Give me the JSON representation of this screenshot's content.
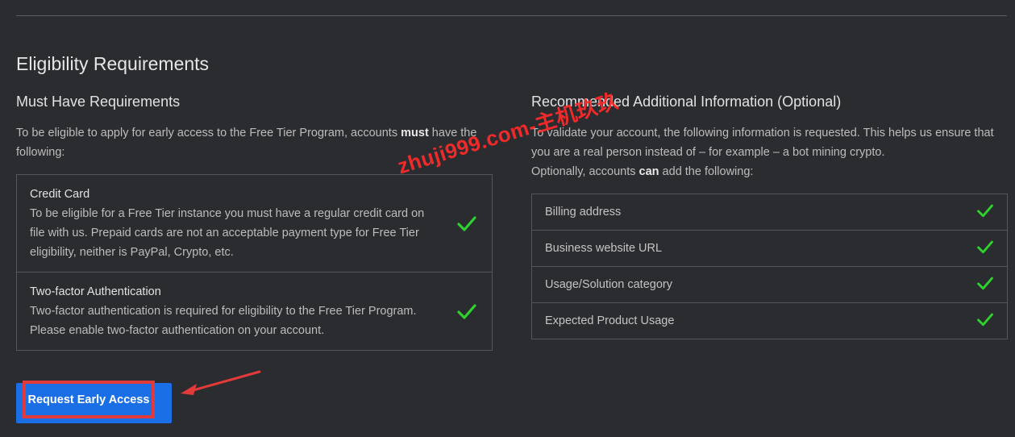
{
  "section": {
    "title": "Eligibility Requirements"
  },
  "must_have": {
    "heading": "Must Have Requirements",
    "intro_pre": "To be eligible to apply for early access to the Free Tier Program, accounts ",
    "intro_bold": "must",
    "intro_post": " have the following:",
    "items": [
      {
        "title": "Credit Card",
        "text": "To be eligible for a Free Tier instance you must have a regular credit card on file with us. Prepaid cards are not an acceptable payment type for Free Tier eligibility, neither is PayPal, Crypto, etc.",
        "icon": "check-icon"
      },
      {
        "title": "Two-factor Authentication",
        "text": "Two-factor authentication is required for eligibility to the Free Tier Program. Please enable two-factor authentication on your account.",
        "icon": "check-icon"
      }
    ]
  },
  "recommended": {
    "heading": "Recommended Additional Information (Optional)",
    "intro_line1": "To validate your account, the following information is requested. This helps us ensure that you are a real person instead of – for example – a bot mining crypto.",
    "intro_pre": "Optionally, accounts ",
    "intro_bold": "can",
    "intro_post": " add the following:",
    "items": [
      {
        "label": "Billing address",
        "icon": "check-icon"
      },
      {
        "label": "Business website URL",
        "icon": "check-icon"
      },
      {
        "label": "Usage/Solution category",
        "icon": "check-icon"
      },
      {
        "label": "Expected Product Usage",
        "icon": "check-icon"
      }
    ]
  },
  "cta": {
    "label": "Request Early Access"
  },
  "watermark": {
    "text": "zhuji999.com-主机玖玖"
  },
  "colors": {
    "background": "#2b2c2f",
    "check": "#2fd12f",
    "button": "#1b6fe6",
    "highlight": "#e23a3a"
  }
}
